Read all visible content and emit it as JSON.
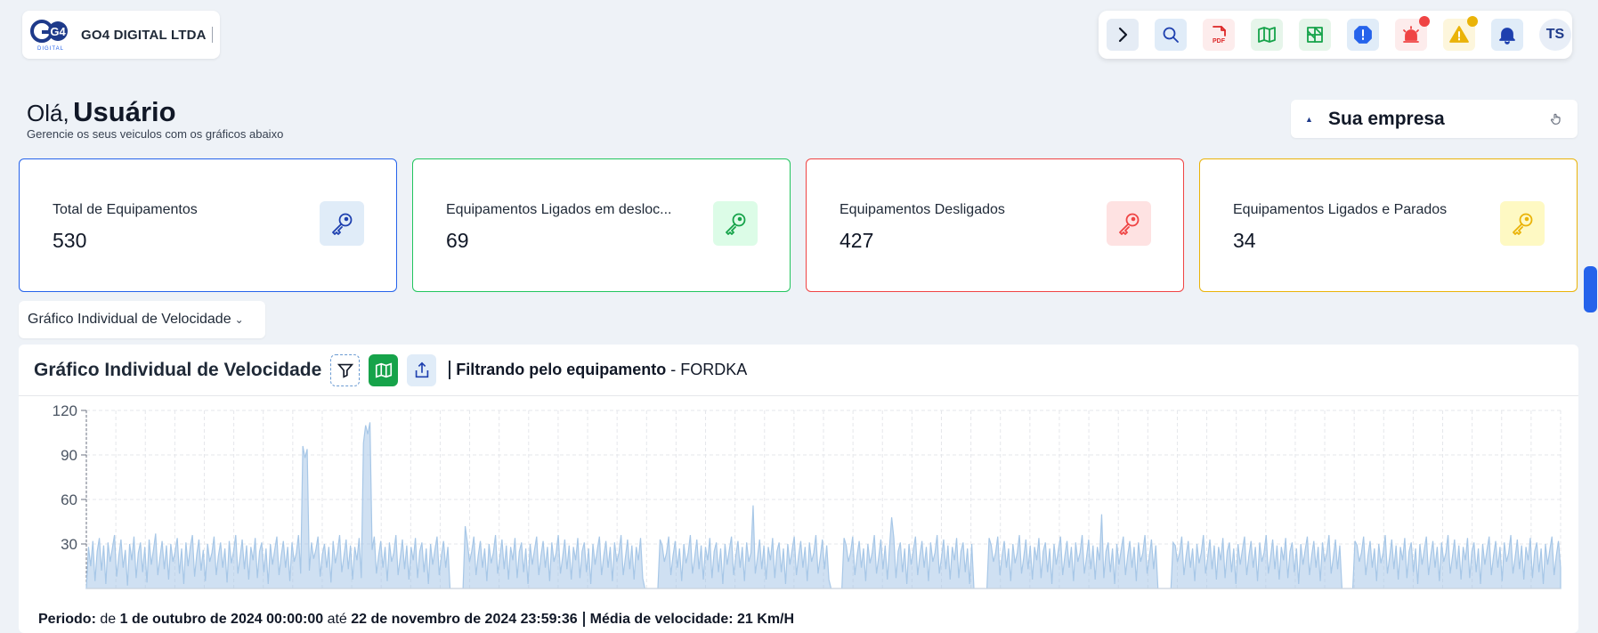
{
  "brand": {
    "logo_text": "G4",
    "logo_sub": "DIGITAL",
    "company_name": "GO4 DIGITAL LTDA"
  },
  "toolbar": {
    "buttons": [
      {
        "name": "expand-icon",
        "bg": "#e5ecf5",
        "color": "#111827"
      },
      {
        "name": "search-icon",
        "bg": "#e0ecf8",
        "color": "#1e40af"
      },
      {
        "name": "pdf-icon",
        "bg": "#fdecec",
        "color": "#dc2626"
      },
      {
        "name": "map-icon",
        "bg": "#e6f5ea",
        "color": "#16a34a"
      },
      {
        "name": "grid-map-icon",
        "bg": "#e6f5ea",
        "color": "#16a34a"
      },
      {
        "name": "alert-octagon-icon",
        "bg": "#e0ecf8",
        "color": "#2563eb"
      },
      {
        "name": "siren-icon",
        "bg": "#fdecec",
        "color": "#ef4444",
        "dot": "#ef4444"
      },
      {
        "name": "warning-icon",
        "bg": "#fdf6dc",
        "color": "#eab308",
        "dot": "#eab308"
      },
      {
        "name": "bell-icon",
        "bg": "#e0ecf8",
        "color": "#1e40af"
      }
    ],
    "avatar_initials": "TS"
  },
  "greeting": {
    "hello": "Olá,",
    "user": "Usuário",
    "subtitle": "Gerencie os seus veiculos com os gráficos abaixo"
  },
  "company_select": {
    "label": "Sua empresa"
  },
  "cards": [
    {
      "title": "Total de Equipamentos",
      "value": "530",
      "accent": "#2563eb",
      "icon_bg": "#e0ecf8",
      "icon_color": "#1e40af"
    },
    {
      "title": "Equipamentos Ligados em desloc...",
      "value": "69",
      "accent": "#22c55e",
      "icon_bg": "#dcfce7",
      "icon_color": "#16a34a"
    },
    {
      "title": "Equipamentos Desligados",
      "value": "427",
      "accent": "#ef4444",
      "icon_bg": "#fee2e2",
      "icon_color": "#ef4444"
    },
    {
      "title": "Equipamentos Ligados e Parados",
      "value": "34",
      "accent": "#eab308",
      "icon_bg": "#fef9c3",
      "icon_color": "#eab308"
    }
  ],
  "chart_selector": {
    "label": "Gráfico Individual de Velocidade"
  },
  "panel": {
    "title": "Gráfico Individual de Velocidade",
    "filter_label": "Filtrando pelo equipamento",
    "filter_sep": " - ",
    "filter_value": "FORDKA",
    "footer": {
      "period_label": "Periodo:",
      "from_word": "de",
      "start": "1 de outubro de 2024 00:00:00",
      "to_word": "até",
      "end": "22 de novembro de 2024 23:59:36",
      "avg_label": "Média de velocidade: 21 Km/H"
    }
  },
  "chart_data": {
    "type": "area",
    "title": "",
    "xlabel": "",
    "ylabel": "",
    "ylim": [
      0,
      120
    ],
    "yticks": [
      "120",
      "90",
      "60",
      "30"
    ],
    "grid": true,
    "color": "#a7c7e7",
    "series": [
      {
        "values": [
          0,
          28,
          15,
          32,
          5,
          25,
          34,
          12,
          29,
          3,
          31,
          18,
          27,
          36,
          8,
          22,
          33,
          14,
          26,
          2,
          30,
          19,
          35,
          7,
          24,
          31,
          11,
          28,
          4,
          33,
          16,
          26,
          37,
          9,
          21,
          32,
          13,
          29,
          6,
          30,
          18,
          25,
          34,
          10,
          27,
          3,
          31,
          15,
          28,
          36,
          8,
          23,
          33,
          12,
          26,
          5,
          30,
          18,
          24,
          35,
          9,
          22,
          31,
          14,
          27,
          4,
          32,
          17,
          25,
          36,
          10,
          21,
          33,
          13,
          29,
          6,
          28,
          19,
          34,
          7,
          25,
          31,
          11,
          27,
          3,
          30,
          16,
          26,
          35,
          9,
          22,
          32,
          14,
          28,
          5,
          31,
          18,
          24,
          36,
          10,
          96,
          88,
          94,
          12,
          31,
          20,
          26,
          35,
          8,
          23,
          30,
          14,
          28,
          4,
          32,
          17,
          25,
          36,
          11,
          22,
          33,
          13,
          29,
          6,
          28,
          19,
          34,
          7,
          98,
          110,
          104,
          112,
          26,
          35,
          10,
          22,
          32,
          14,
          28,
          5,
          31,
          18,
          24,
          36,
          9,
          21,
          33,
          13,
          29,
          6,
          28,
          19,
          34,
          7,
          25,
          31,
          11,
          27,
          3,
          30,
          16,
          26,
          35,
          9,
          22,
          32,
          14,
          28,
          0,
          0,
          0,
          0,
          0,
          0,
          0,
          42,
          31,
          18,
          25,
          35,
          9,
          22,
          32,
          14,
          27,
          5,
          30,
          17,
          24,
          36,
          10,
          21,
          33,
          13,
          29,
          6,
          28,
          19,
          34,
          7,
          25,
          31,
          11,
          27,
          3,
          30,
          16,
          26,
          35,
          9,
          22,
          32,
          14,
          28,
          5,
          31,
          18,
          24,
          36,
          10,
          21,
          33,
          13,
          29,
          6,
          28,
          19,
          34,
          7,
          25,
          31,
          11,
          27,
          3,
          30,
          16,
          26,
          35,
          9,
          22,
          32,
          14,
          28,
          5,
          31,
          18,
          24,
          36,
          9,
          21,
          33,
          13,
          29,
          6,
          28,
          19,
          34,
          7,
          0,
          0,
          0,
          0,
          0,
          0,
          0,
          33,
          29,
          18,
          24,
          35,
          9,
          22,
          32,
          14,
          27,
          5,
          30,
          17,
          24,
          36,
          10,
          21,
          33,
          13,
          29,
          6,
          28,
          19,
          34,
          7,
          25,
          31,
          11,
          27,
          3,
          30,
          16,
          26,
          35,
          9,
          22,
          32,
          14,
          28,
          5,
          31,
          18,
          24,
          56,
          10,
          21,
          33,
          13,
          29,
          6,
          28,
          19,
          34,
          7,
          25,
          31,
          11,
          27,
          3,
          30,
          16,
          26,
          35,
          9,
          22,
          32,
          14,
          28,
          5,
          31,
          18,
          24,
          36,
          10,
          21,
          33,
          13,
          29,
          6,
          0,
          0,
          0,
          0,
          0,
          0,
          34,
          29,
          18,
          24,
          35,
          9,
          22,
          32,
          14,
          27,
          5,
          30,
          17,
          24,
          36,
          10,
          21,
          33,
          13,
          29,
          6,
          28,
          48,
          34,
          7,
          25,
          31,
          11,
          27,
          3,
          30,
          16,
          26,
          35,
          9,
          22,
          32,
          14,
          28,
          5,
          31,
          18,
          24,
          36,
          10,
          21,
          33,
          13,
          29,
          6,
          28,
          19,
          34,
          7,
          25,
          31,
          11,
          27,
          3,
          30,
          0,
          0,
          0,
          0,
          0,
          0,
          0,
          34,
          29,
          18,
          24,
          35,
          9,
          22,
          32,
          14,
          27,
          5,
          30,
          17,
          24,
          36,
          10,
          21,
          33,
          13,
          29,
          6,
          28,
          19,
          34,
          7,
          25,
          31,
          11,
          27,
          3,
          30,
          16,
          26,
          35,
          9,
          22,
          32,
          14,
          28,
          5,
          31,
          18,
          24,
          36,
          10,
          21,
          33,
          13,
          29,
          6,
          28,
          19,
          50,
          7,
          25,
          31,
          11,
          27,
          3,
          30,
          16,
          26,
          35,
          9,
          22,
          32,
          14,
          28,
          5,
          31,
          18,
          24,
          36,
          10,
          21,
          33,
          13,
          29,
          0,
          0,
          0,
          0,
          0,
          0,
          0,
          31,
          29,
          18,
          24,
          35,
          9,
          22,
          32,
          14,
          27,
          5,
          30,
          17,
          24,
          36,
          10,
          21,
          33,
          13,
          29,
          6,
          28,
          19,
          34,
          7,
          25,
          31,
          11,
          27,
          3,
          30,
          16,
          26,
          35,
          9,
          22,
          32,
          14,
          28,
          5,
          31,
          18,
          24,
          36,
          10,
          21,
          33,
          13,
          29,
          6,
          28,
          19,
          34,
          7,
          25,
          31,
          11,
          27,
          3,
          30,
          16,
          26,
          35,
          9,
          22,
          32,
          14,
          28,
          5,
          31,
          18,
          24,
          36,
          10,
          21,
          33,
          13,
          29,
          0,
          0,
          0,
          0,
          0,
          0,
          32,
          29,
          18,
          24,
          35,
          9,
          22,
          32,
          14,
          27,
          5,
          30,
          17,
          24,
          36,
          10,
          21,
          33,
          13,
          29,
          6,
          28,
          19,
          34,
          7,
          25,
          31,
          11,
          27,
          3,
          30,
          16,
          26,
          35,
          9,
          22,
          32,
          14,
          28,
          5,
          31,
          18,
          24,
          36,
          10,
          21,
          33,
          13,
          29,
          6,
          28,
          19,
          34,
          7,
          25,
          31,
          11,
          27,
          3,
          30,
          16,
          26,
          35,
          9,
          22,
          32,
          14,
          28,
          5,
          31,
          18,
          24,
          36,
          10,
          21,
          33,
          13,
          29,
          6,
          28,
          19,
          34,
          7,
          25,
          31,
          11,
          27,
          3,
          30,
          16,
          26,
          35,
          9,
          22,
          32,
          14
        ]
      }
    ]
  }
}
